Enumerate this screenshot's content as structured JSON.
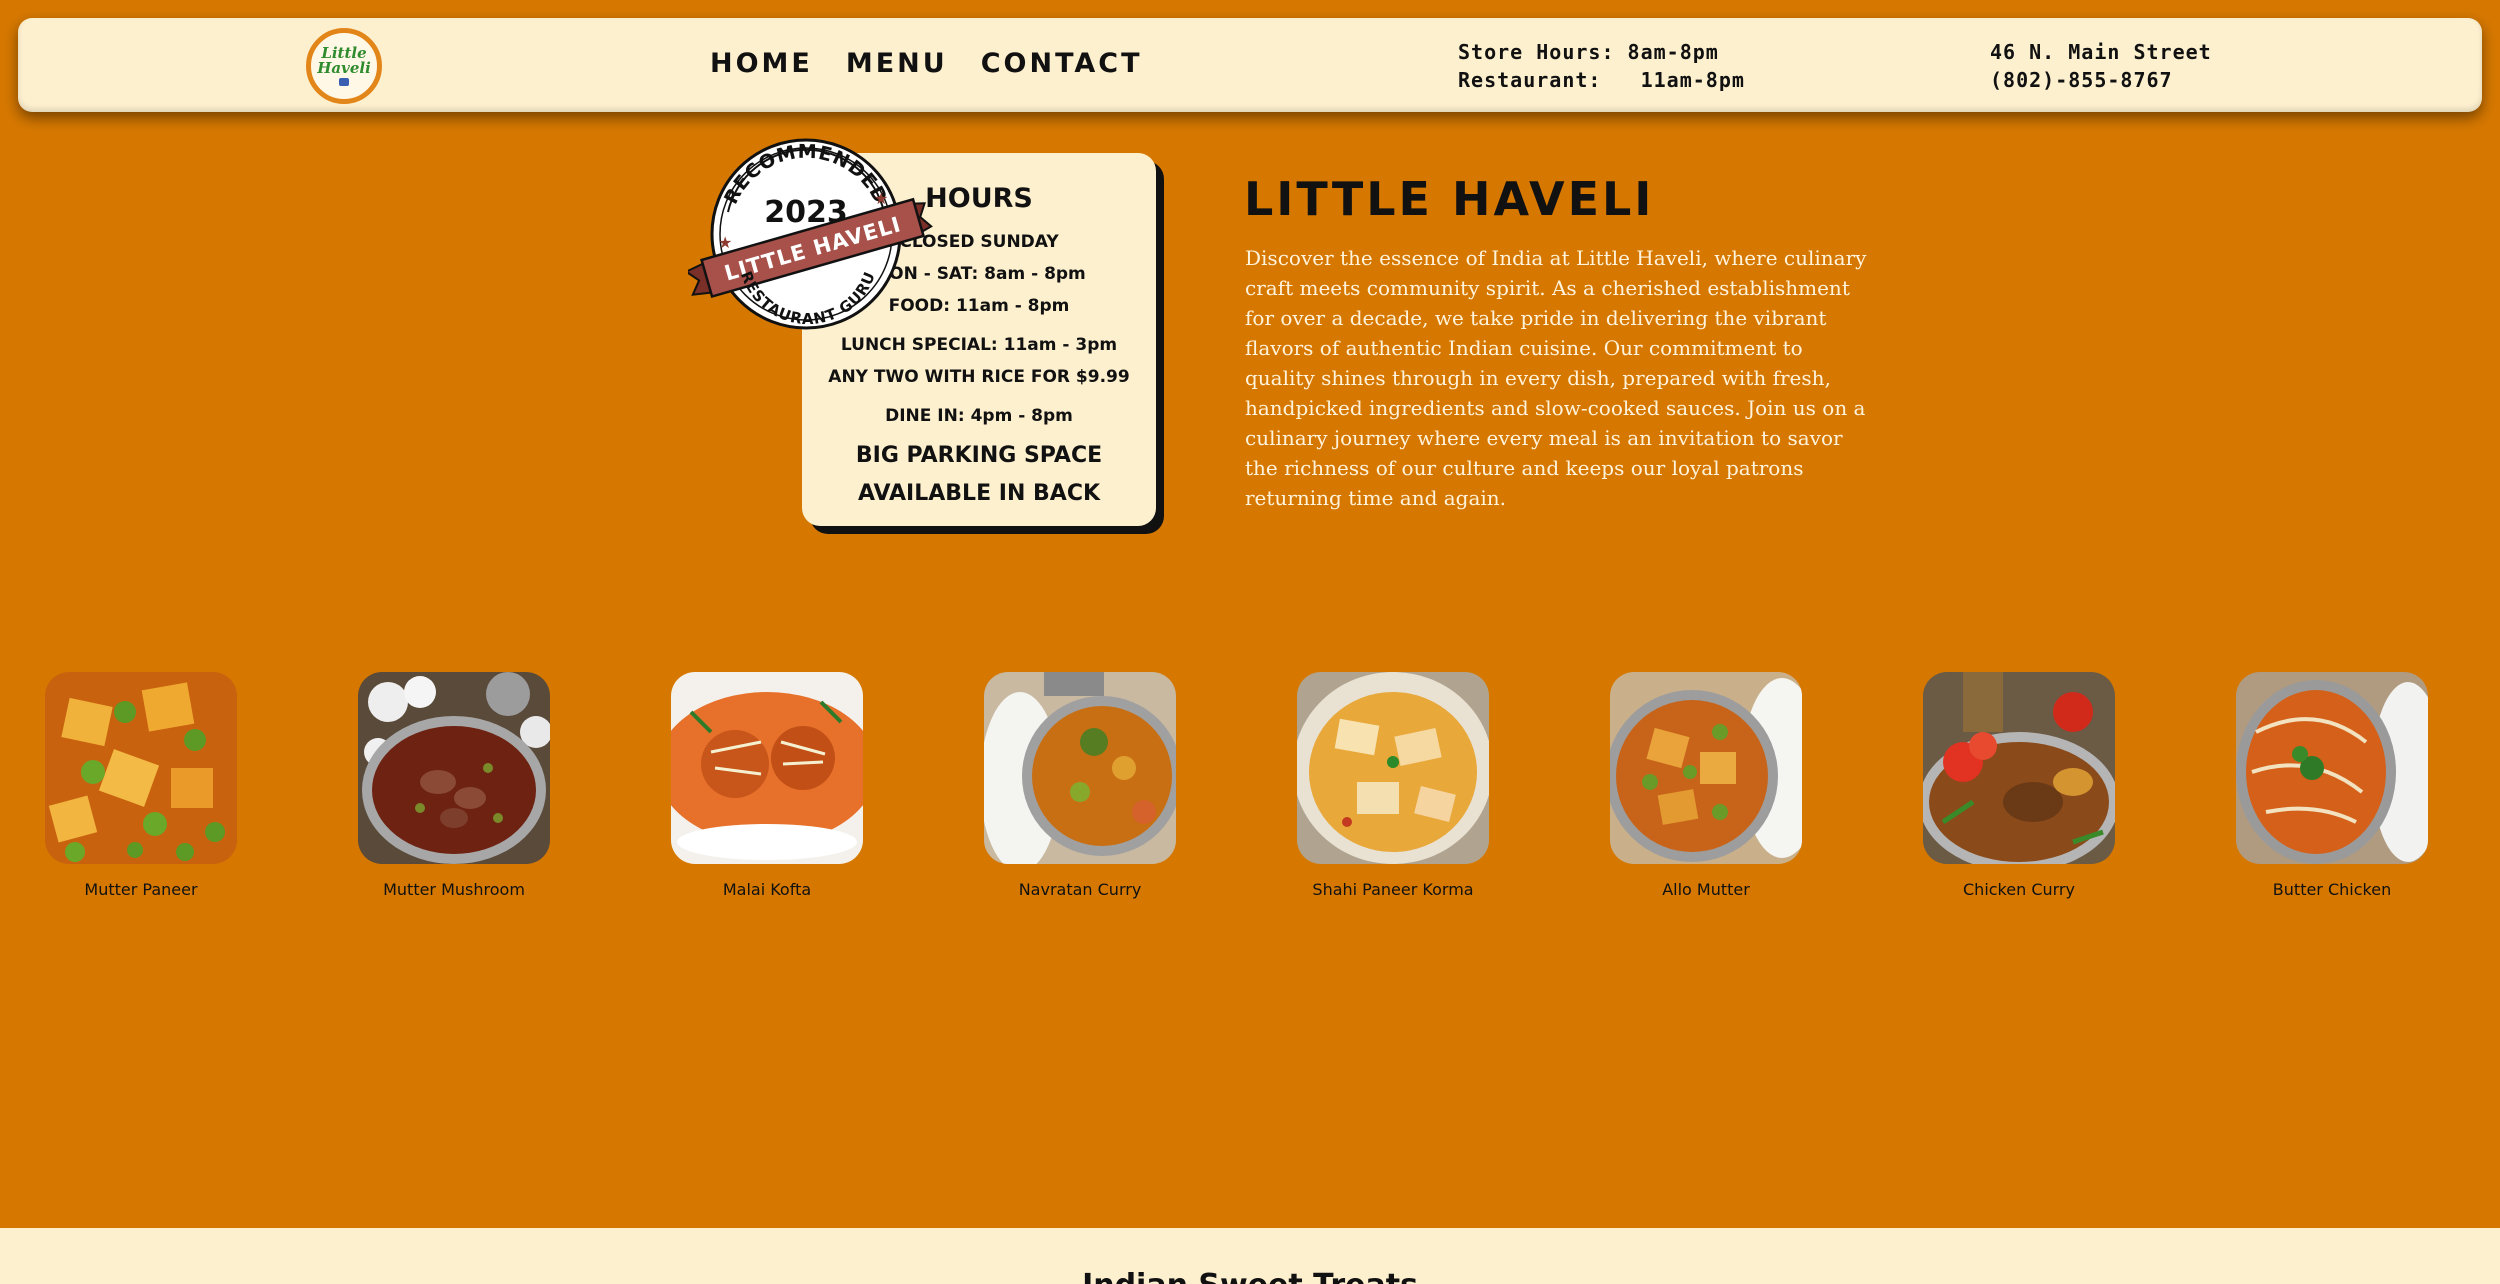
{
  "header": {
    "logo": {
      "line1": "Little",
      "line2": "Haveli"
    },
    "nav": [
      {
        "label": "HOME"
      },
      {
        "label": "MENU"
      },
      {
        "label": "CONTACT"
      }
    ],
    "store_hours": "Store Hours: 8am-8pm",
    "restaurant_hours": "Restaurant:   11am-8pm",
    "address": "46 N. Main Street",
    "phone": "(802)-855-8767"
  },
  "badge": {
    "top_text": "RECOMMENDED",
    "year": "2023",
    "ribbon_text": "LITTLE HAVELI",
    "bottom_text": "RESTAURANT GURU"
  },
  "hours_card": {
    "title": "HOURS",
    "closed": "CLOSED SUNDAY",
    "mon_sat": "MON - SAT: 8am - 8pm",
    "food": "FOOD: 11am - 8pm",
    "lunch": "LUNCH SPECIAL: 11am - 3pm",
    "lunch_offer": "ANY TWO WITH RICE FOR $9.99",
    "dine_in": "DINE IN: 4pm - 8pm",
    "parking_1": "BIG PARKING SPACE",
    "parking_2": "AVAILABLE IN BACK"
  },
  "about": {
    "title": "LITTLE HAVELI",
    "text": "Discover the essence of India at Little Haveli, where culinary craft meets community spirit. As a cherished establishment for over a decade, we take pride in delivering the vibrant flavors of authentic Indian cuisine. Our commitment to quality shines through in every dish, prepared with fresh, handpicked ingredients and slow-cooked sauces. Join us on a culinary journey where every meal is an invitation to savor the richness of our culture and keeps our loyal patrons returning time and again."
  },
  "dishes": [
    {
      "name": "Mutter Paneer"
    },
    {
      "name": "Mutter Mushroom"
    },
    {
      "name": "Malai Kofta"
    },
    {
      "name": "Navratan Curry"
    },
    {
      "name": "Shahi Paneer Korma"
    },
    {
      "name": "Allo Mutter"
    },
    {
      "name": "Chicken Curry"
    },
    {
      "name": "Butter Chicken"
    }
  ],
  "footer": {
    "heading": "Indian Sweet Treats"
  },
  "colors": {
    "page_bg": "#d67800",
    "cream": "#fdf0cf",
    "ribbon": "#a8514a",
    "text_dark": "#111111",
    "about_text": "#fff3dc"
  }
}
